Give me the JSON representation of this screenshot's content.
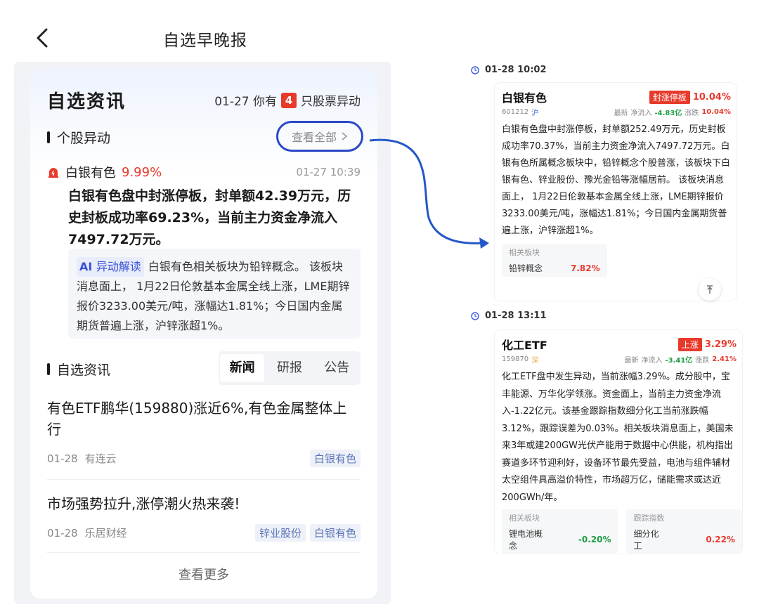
{
  "header": {
    "title": "自选早晚报",
    "back_icon": "chevron-left-icon"
  },
  "card": {
    "title": "自选资讯",
    "sub_prefix": "01-27 你有",
    "sub_count": "4",
    "sub_suffix": "只股票异动"
  },
  "movers": {
    "section_label": "个股异动",
    "view_all": "查看全部",
    "stock_name": "白银有色",
    "stock_pct": "9.99%",
    "time": "01-27 10:39",
    "headline": "白银有色盘中封涨停板，封单额42.39万元，历史封板成功率69.23%，当前主力资金净流入7497.72万元。",
    "ai_tag": "异动解读",
    "ai_text": "白银有色相关板块为铅锌概念。 该板块消息面上， 1月22日伦敦基本金属全线上涨，LME期锌报价3233.00美元/吨，涨幅达1.81%；今日国内金属期货普遍上涨，沪锌涨超1%。"
  },
  "news_section": {
    "label": "自选资讯",
    "tabs": [
      "新闻",
      "研报",
      "公告"
    ],
    "active_tab": 0,
    "items": [
      {
        "title": "有色ETF鹏华(159880)涨近6%,有色金属整体上行",
        "date": "01-28",
        "source": "有连云",
        "tags": [
          "白银有色"
        ]
      },
      {
        "title": "市场强势拉升,涨停潮火热来袭!",
        "date": "01-28",
        "source": "乐居财经",
        "tags": [
          "锌业股份",
          "白银有色"
        ]
      }
    ],
    "more": "查看更多"
  },
  "right_panel_1": {
    "time": "01-28 10:02",
    "name": "白银有色",
    "status_tag": "封涨停板",
    "pct": "10.04%",
    "code": "601212",
    "market": "沪",
    "latest_label": "最新",
    "inflow_label": "净流入",
    "inflow": "-4.83亿",
    "change_label": "涨跌",
    "change": "10.04%",
    "body": "白银有色盘中封涨停板，封单额252.49万元，历史封板成功率70.37%，当前主力资金净流入7497.72万元。白银有色所属概念板块中，铅锌概念个股普涨，该板块下白银有色、锌业股份、豫光金铅等涨幅居前。 该板块消息面上， 1月22日伦敦基本金属全线上涨，LME期锌报价3233.00美元/吨，涨幅达1.81%；今日国内金属期货普遍上涨，沪锌涨超1%。",
    "sector_label": "相关板块",
    "sector_name": "铅锌概念",
    "sector_pct": "7.82%"
  },
  "right_panel_2": {
    "time": "01-28 13:11",
    "name": "化工ETF",
    "status_tag": "上涨",
    "pct": "3.29%",
    "code": "159870",
    "market": "深",
    "latest_label": "最新",
    "inflow_label": "净流入",
    "inflow": "-3.41亿",
    "change_label": "涨跌",
    "change": "2.41%",
    "body": "化工ETF盘中发生异动，当前涨幅3.29%。成分股中，宝丰能源、万华化学领涨。资金面上，当前主力资金净流入-1.22亿元。该基金跟踪指数细分化工当前涨跌幅3.12%，跟踪误差为0.03%。相关板块消息面上，美国未来3年或建200GW光伏产能用于数据中心供能，机构指出赛道多环节迎利好，设备环节最先受益，电池与组件辅材太空组件具高溢价特性，市场超万亿，储能需求或达近200GWh/年。",
    "sector_label": "相关板块",
    "sector_name": "锂电池概念",
    "sector_pct": "-0.20%",
    "index_label": "跟踪指数",
    "index_name": "细分化工",
    "index_pct": "0.22%"
  }
}
